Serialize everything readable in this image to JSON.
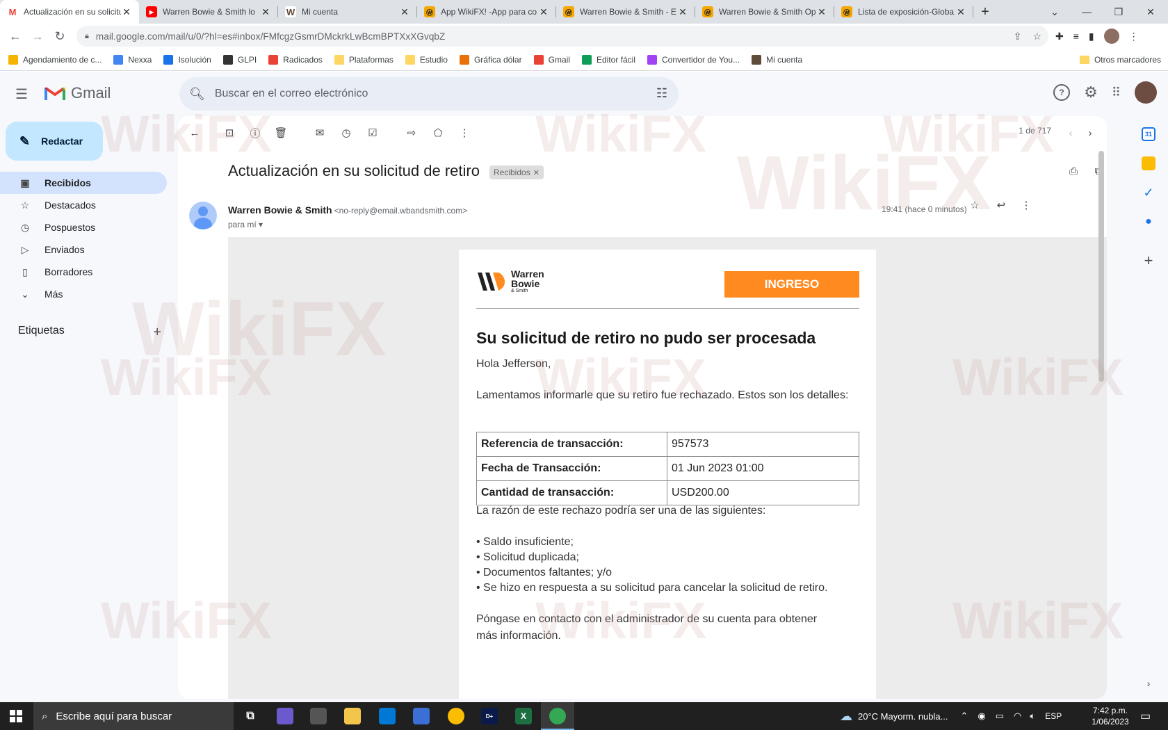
{
  "browser": {
    "tabs": [
      {
        "title": "Actualización en su solicitud",
        "icon": "gmail-icon",
        "active": true
      },
      {
        "title": "Warren Bowie & Smith lo",
        "icon": "youtube-icon"
      },
      {
        "title": "Mi cuenta",
        "icon": "wbs-icon"
      },
      {
        "title": "App WikiFX! -App para co",
        "icon": "wikifx-icon"
      },
      {
        "title": "Warren Bowie & Smith - E",
        "icon": "wikifx-icon"
      },
      {
        "title": "Warren Bowie & Smith Op",
        "icon": "wikifx-icon"
      },
      {
        "title": "Lista de exposición-Globa",
        "icon": "wikifx-icon"
      }
    ],
    "url": "mail.google.com/mail/u/0/?hl=es#inbox/FMfcgzGsmrDMckrkLwBcmBPTXxXGvqbZ",
    "bookmarks": [
      {
        "label": "Agendamiento de c...",
        "color": "#f4b400"
      },
      {
        "label": "Nexxa",
        "color": "#4285f4"
      },
      {
        "label": "Isolución",
        "color": "#1a73e8"
      },
      {
        "label": "GLPI",
        "color": "#333333"
      },
      {
        "label": "Radicados",
        "color": "#ea4335"
      },
      {
        "label": "Plataformas",
        "color": "#fdd663"
      },
      {
        "label": "Estudio",
        "color": "#fdd663"
      },
      {
        "label": "Gráfica dólar",
        "color": "#e8710a"
      },
      {
        "label": "Gmail",
        "color": "#ea4335"
      },
      {
        "label": "Editor fácil",
        "color": "#0f9d58"
      },
      {
        "label": "Convertidor de You...",
        "color": "#a142f4"
      },
      {
        "label": "Mi cuenta",
        "color": "#5f4b3a"
      }
    ],
    "other_bookmarks": "Otros marcadores"
  },
  "gmail": {
    "app_name": "Gmail",
    "search_placeholder": "Buscar en el correo electrónico",
    "compose_label": "Redactar",
    "nav": [
      {
        "label": "Recibidos",
        "icon": "inbox-icon",
        "active": true
      },
      {
        "label": "Destacados",
        "icon": "star-icon"
      },
      {
        "label": "Pospuestos",
        "icon": "clock-icon"
      },
      {
        "label": "Enviados",
        "icon": "send-icon"
      },
      {
        "label": "Borradores",
        "icon": "draft-icon"
      },
      {
        "label": "Más",
        "icon": "chevron-down-icon"
      }
    ],
    "labels_title": "Etiquetas",
    "pager": "1 de 717",
    "subject": "Actualización en su solicitud de retiro",
    "label_badge": "Recibidos",
    "sender_name": "Warren Bowie & Smith",
    "sender_email": "<no-reply@email.wbandsmith.com>",
    "to_me": "para mí",
    "time": "19:41 (hace 0 minutos)"
  },
  "email": {
    "logo_line1": "Warren",
    "logo_line2": "Bowie",
    "logo_line3": "& Smith",
    "ingreso_button": "INGRESO",
    "title": "Su solicitud de retiro no pudo ser procesada",
    "greeting": "Hola Jefferson,",
    "intro": "Lamentamos informarle que su retiro fue rechazado. Estos son los detalles:",
    "details": [
      {
        "key": "Referencia de transacción:",
        "value": "957573"
      },
      {
        "key": "Fecha de Transacción:",
        "value": "01 Jun 2023 01:00"
      },
      {
        "key": "Cantidad de transacción:",
        "value": "USD200.00"
      }
    ],
    "reasons_intro": "La razón de este rechazo podría ser una de las siguientes:",
    "reasons": [
      "• Saldo insuficiente;",
      "• Solicitud duplicada;",
      "• Documentos faltantes; y/o",
      "• Se hizo en respuesta a su solicitud para cancelar la solicitud de retiro."
    ],
    "contact": "Póngase en contacto con el administrador de su cuenta para obtener más información."
  },
  "taskbar": {
    "search_placeholder": "Escribe aquí para buscar",
    "weather": "20°C  Mayorm. nubla...",
    "language": "ESP",
    "time": "7:42 p.m.",
    "date": "1/06/2023"
  },
  "watermark": "WikiFX",
  "colors": {
    "accent_orange": "#ff8a1f",
    "nav_active": "#d3e3fd",
    "compose_bg": "#c2e7ff"
  }
}
